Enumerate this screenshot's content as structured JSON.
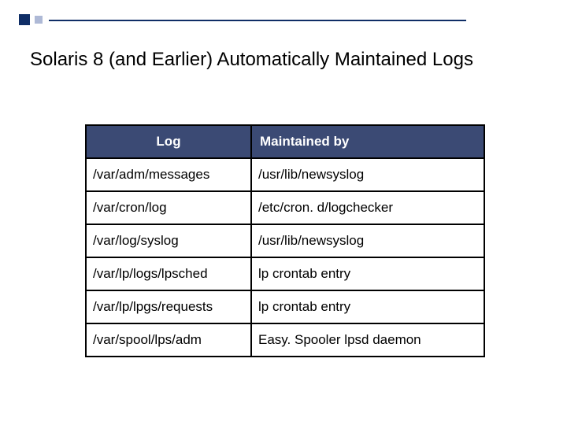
{
  "slide": {
    "title": "Solaris 8 (and Earlier) Automatically Maintained Logs"
  },
  "table": {
    "headers": {
      "log": "Log",
      "maintained": "Maintained by"
    },
    "rows": [
      {
        "log": "/var/adm/messages",
        "maintained": "/usr/lib/newsyslog"
      },
      {
        "log": "/var/cron/log",
        "maintained": "/etc/cron. d/logchecker"
      },
      {
        "log": "/var/log/syslog",
        "maintained": "/usr/lib/newsyslog"
      },
      {
        "log": "/var/lp/logs/lpsched",
        "maintained": "lp crontab entry"
      },
      {
        "log": "/var/lp/lpgs/requests",
        "maintained": "lp crontab entry"
      },
      {
        "log": "/var/spool/lps/adm",
        "maintained": "Easy. Spooler lpsd daemon"
      }
    ]
  }
}
